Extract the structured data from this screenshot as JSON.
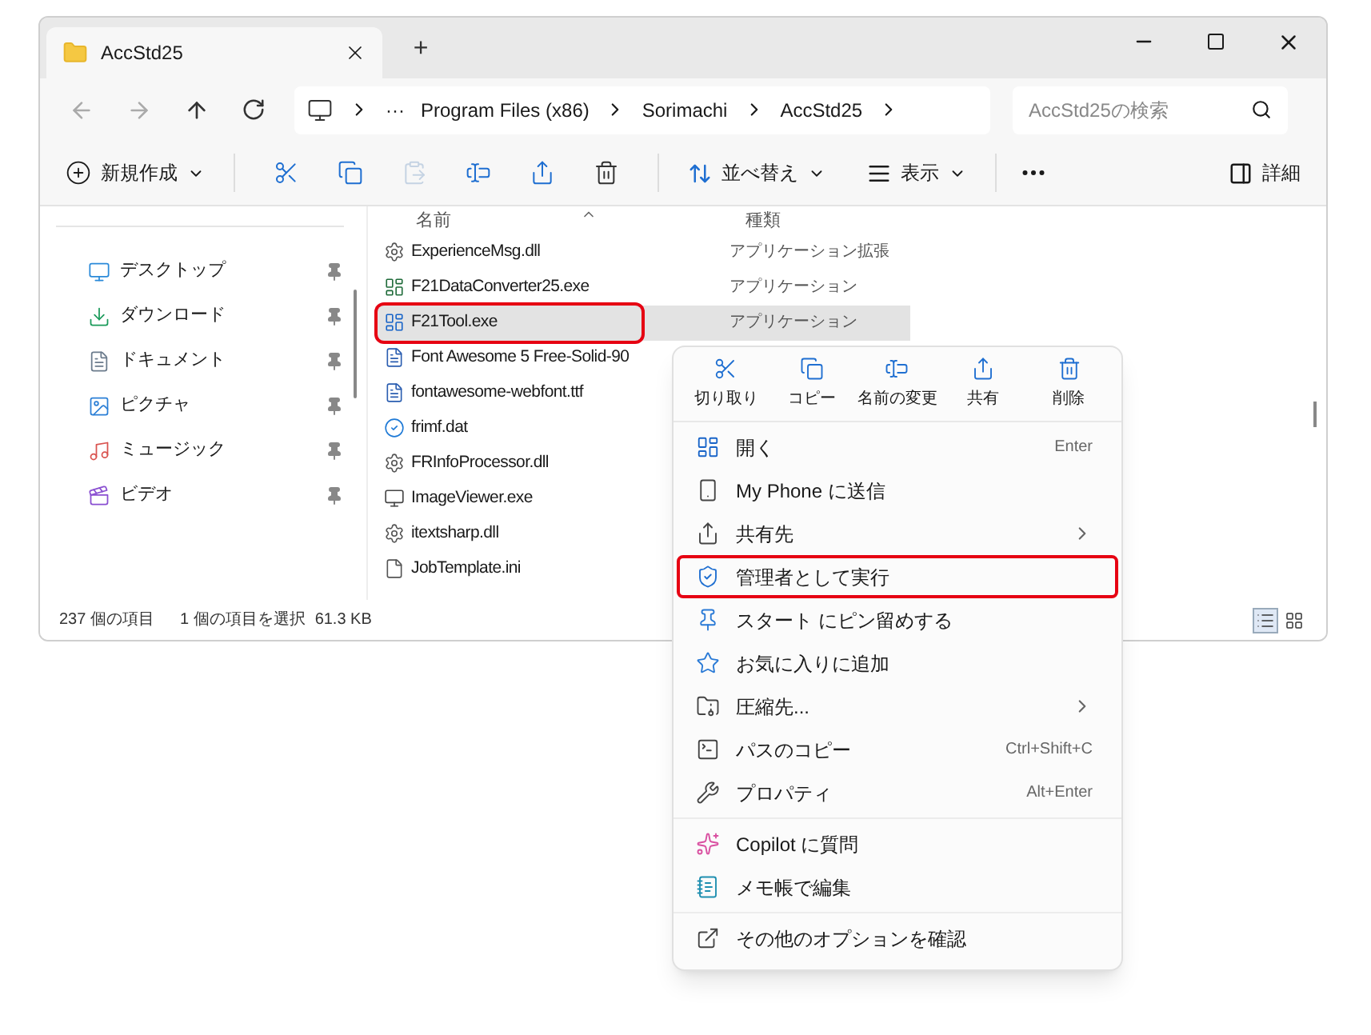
{
  "window": {
    "tab_title": "AccStd25",
    "new_tab": "+"
  },
  "address": {
    "overflow": "···",
    "crumbs": [
      "Program Files (x86)",
      "Sorimachi",
      "AccStd25"
    ],
    "search_placeholder": "AccStd25の検索"
  },
  "toolbar": {
    "new_label": "新規作成",
    "paste_disabled": true,
    "sort_label": "並べ替え",
    "view_label": "表示",
    "details_label": "詳細"
  },
  "sidebar": {
    "items": [
      {
        "label": "デスクトップ",
        "pinned": true
      },
      {
        "label": "ダウンロード",
        "pinned": true
      },
      {
        "label": "ドキュメント",
        "pinned": true
      },
      {
        "label": "ピクチャ",
        "pinned": true
      },
      {
        "label": "ミュージック",
        "pinned": true
      },
      {
        "label": "ビデオ",
        "pinned": true
      }
    ]
  },
  "table": {
    "columns": [
      "名前",
      "種類"
    ],
    "rows": [
      {
        "kind": "dll",
        "name": "ExperienceMsg.dll",
        "type": "アプリケーション拡張",
        "selected": false,
        "highlighted": false
      },
      {
        "kind": "app",
        "name": "F21DataConverter25.exe",
        "type": "アプリケーション",
        "selected": false,
        "highlighted": false
      },
      {
        "kind": "tool",
        "name": "F21Tool.exe",
        "type": "アプリケーション",
        "selected": true,
        "highlighted": true
      },
      {
        "kind": "font",
        "name": "Font Awesome 5 Free-Solid-90",
        "selected": false,
        "highlighted": false
      },
      {
        "kind": "font",
        "name": "fontawesome-webfont.ttf",
        "selected": false,
        "highlighted": false
      },
      {
        "kind": "dat",
        "name": "frimf.dat",
        "selected": false,
        "highlighted": false
      },
      {
        "kind": "dll",
        "name": "FRInfoProcessor.dll",
        "selected": false,
        "highlighted": false
      },
      {
        "kind": "viewer",
        "name": "ImageViewer.exe",
        "selected": false,
        "highlighted": false
      },
      {
        "kind": "dll",
        "name": "itextsharp.dll",
        "selected": false,
        "highlighted": false
      },
      {
        "kind": "ini",
        "name": "JobTemplate.ini",
        "selected": false,
        "highlighted": false
      }
    ]
  },
  "status_bar": {
    "count": "237 個の項目",
    "selection": "1 個の項目を選択",
    "size": "61.3 KB",
    "view_buttons": [
      {
        "kind": "details",
        "selected": true
      },
      {
        "kind": "tiles",
        "selected": false
      }
    ]
  },
  "context_menu": {
    "actions": [
      "切り取り",
      "コピー",
      "名前の変更",
      "共有",
      "削除"
    ],
    "groups": [
      [
        {
          "label": "開く",
          "shortcut": "Enter",
          "submenu": false,
          "highlighted": false
        },
        {
          "label": "My Phone に送信",
          "submenu": false,
          "highlighted": false
        },
        {
          "label": "共有先",
          "submenu": true,
          "highlighted": false
        },
        {
          "label": "管理者として実行",
          "submenu": false,
          "highlighted": true
        },
        {
          "label": "スタート にピン留めする",
          "submenu": false,
          "highlighted": false
        },
        {
          "label": "お気に入りに追加",
          "submenu": false,
          "highlighted": false
        },
        {
          "label": "圧縮先...",
          "submenu": true,
          "highlighted": false
        },
        {
          "label": "パスのコピー",
          "shortcut": "Ctrl+Shift+C",
          "submenu": false,
          "highlighted": false
        },
        {
          "label": "プロパティ",
          "shortcut": "Alt+Enter",
          "submenu": false,
          "highlighted": false
        }
      ],
      [
        {
          "label": "Copilot に質問",
          "submenu": false,
          "highlighted": false
        },
        {
          "label": "メモ帳で編集",
          "submenu": false,
          "highlighted": false
        }
      ],
      [
        {
          "label": "その他のオプションを確認",
          "submenu": false,
          "highlighted": false
        }
      ]
    ]
  }
}
